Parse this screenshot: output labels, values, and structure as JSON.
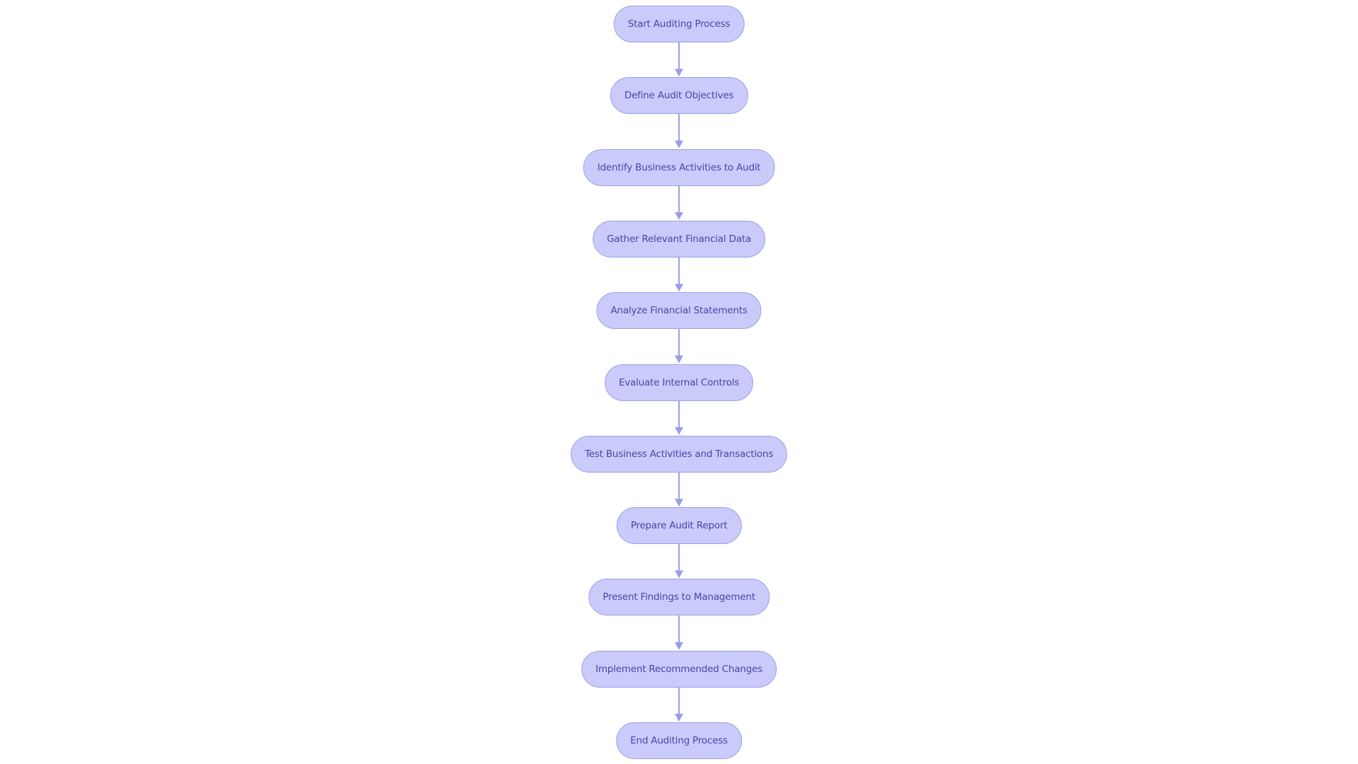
{
  "diagram": {
    "type": "flowchart",
    "direction": "top-down",
    "colors": {
      "node_fill": "#cbcbfb",
      "node_border": "#9b9de8",
      "node_text": "#4446a8",
      "edge": "#9b9de8"
    },
    "nodes": [
      {
        "id": "n1",
        "label": "Start Auditing Process"
      },
      {
        "id": "n2",
        "label": "Define Audit Objectives"
      },
      {
        "id": "n3",
        "label": "Identify Business Activities to Audit"
      },
      {
        "id": "n4",
        "label": "Gather Relevant Financial Data"
      },
      {
        "id": "n5",
        "label": "Analyze Financial Statements"
      },
      {
        "id": "n6",
        "label": "Evaluate Internal Controls"
      },
      {
        "id": "n7",
        "label": "Test Business Activities and Transactions"
      },
      {
        "id": "n8",
        "label": "Prepare Audit Report"
      },
      {
        "id": "n9",
        "label": "Present Findings to Management"
      },
      {
        "id": "n10",
        "label": "Implement Recommended Changes"
      },
      {
        "id": "n11",
        "label": "End Auditing Process"
      }
    ],
    "edges": [
      {
        "from": "n1",
        "to": "n2"
      },
      {
        "from": "n2",
        "to": "n3"
      },
      {
        "from": "n3",
        "to": "n4"
      },
      {
        "from": "n4",
        "to": "n5"
      },
      {
        "from": "n5",
        "to": "n6"
      },
      {
        "from": "n6",
        "to": "n7"
      },
      {
        "from": "n7",
        "to": "n8"
      },
      {
        "from": "n8",
        "to": "n9"
      },
      {
        "from": "n9",
        "to": "n10"
      },
      {
        "from": "n10",
        "to": "n11"
      }
    ]
  }
}
